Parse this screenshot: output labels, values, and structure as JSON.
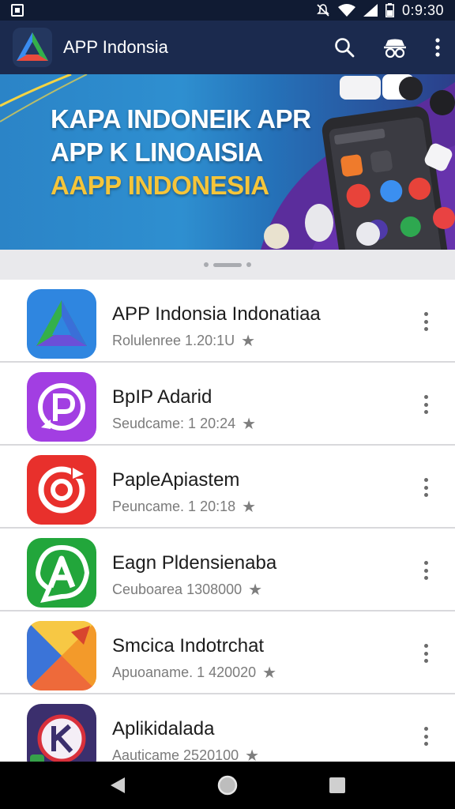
{
  "status_bar": {
    "time": "0:9:30",
    "icons": [
      "notification-icon",
      "mute-icon",
      "wifi-icon",
      "signal-icon",
      "battery-icon"
    ]
  },
  "app_bar": {
    "title": "APP Indonsia",
    "icons": [
      "search-icon",
      "incognito-icon",
      "more-vertical-icon"
    ],
    "colors": {
      "background": "#1b2a4e"
    }
  },
  "banner": {
    "lines": [
      "KAPA INDONEIK APR",
      "APP K LINOAISIA",
      "AAPP INDONESIA"
    ],
    "colors": {
      "text": "#ffffff",
      "accent": "#f5c53a"
    }
  },
  "apps": [
    {
      "title": "APP Indonsia Indonatiaa",
      "meta": "Rolulenree 1.20:1U",
      "icon": "prism-triangle-icon",
      "icon_color": "#2c78d4"
    },
    {
      "title": "BpIP Adarid",
      "meta": "Seudcame: 1 20:24",
      "icon": "speech-p-icon",
      "icon_color": "#a03ee0"
    },
    {
      "title": "PapleApiastem",
      "meta": "Peuncame. 1 20:18",
      "icon": "refresh-circle-icon",
      "icon_color": "#e8302c"
    },
    {
      "title": "Eagn Pldensienaba",
      "meta": "Ceuboarea 1308000",
      "icon": "letter-a-bubble-icon",
      "icon_color": "#22a63b"
    },
    {
      "title": "Smcica Indotrchat",
      "meta": "Apuoaname. 1 420020",
      "icon": "folded-arrow-icon",
      "icon_color": "#f2a225"
    },
    {
      "title": "Aplikidalada",
      "meta": "Aauticame 2520100",
      "icon": "k-circle-icon",
      "icon_color": "#3b2f6d"
    }
  ],
  "nav": {
    "icons": [
      "back-icon",
      "home-icon",
      "recents-icon"
    ]
  }
}
